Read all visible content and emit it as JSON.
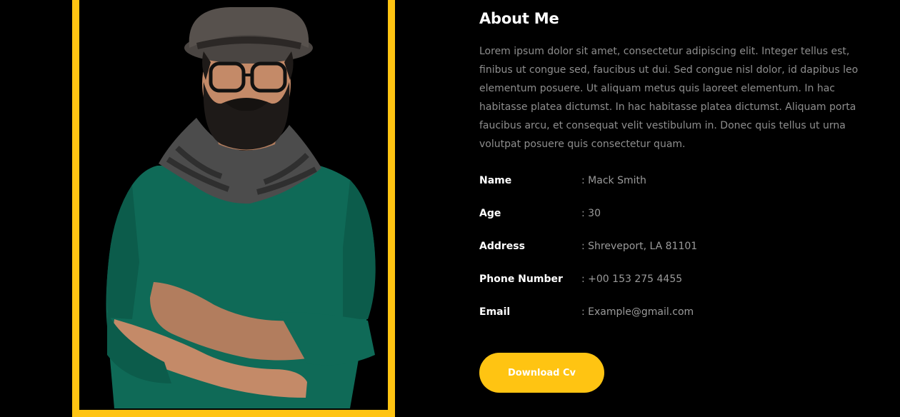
{
  "profile_photo": {
    "icon": "person-portrait",
    "accent_color": "#ffc412"
  },
  "about": {
    "title": "About Me",
    "text": "Lorem ipsum dolor sit amet, consectetur adipiscing elit. Integer tellus est, finibus ut congue sed, faucibus ut dui. Sed congue nisl dolor, id dapibus leo elementum posuere. Ut aliquam metus quis laoreet elementum. In hac habitasse platea dictumst. In hac habitasse platea dictumst. Aliquam porta faucibus arcu, et consequat velit vestibulum in. Donec quis tellus ut urna volutpat posuere quis consectetur quam."
  },
  "info": [
    {
      "label": "Name",
      "colon": ": ",
      "value": "Mack Smith"
    },
    {
      "label": "Age",
      "colon": ": ",
      "value": "30"
    },
    {
      "label": "Address",
      "colon": ": ",
      "value": "Shreveport, LA 81101"
    },
    {
      "label": "Phone Number",
      "colon": ": ",
      "value": "+00 153 275 4455"
    },
    {
      "label": "Email",
      "colon": ": ",
      "value": "Example@gmail.com"
    }
  ],
  "button": {
    "label": "Download Cv"
  },
  "colors": {
    "background": "#000000",
    "accent": "#ffc412",
    "heading": "#ffffff",
    "body_text": "#8e8e8e"
  }
}
